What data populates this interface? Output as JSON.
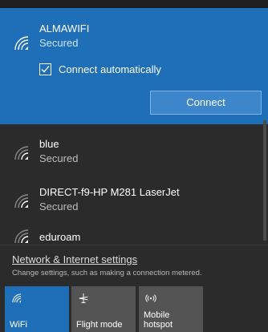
{
  "selected_network": {
    "ssid": "ALMAWIFI",
    "status": "Secured",
    "auto_connect_label": "Connect automatically",
    "auto_connect_checked": true,
    "connect_label": "Connect",
    "icon": "wifi-secured-icon"
  },
  "networks": [
    {
      "ssid": "blue",
      "status": "Secured",
      "icon": "wifi-secured-icon"
    },
    {
      "ssid": "DIRECT-f9-HP M281 LaserJet",
      "status": "Secured",
      "icon": "wifi-secured-icon"
    },
    {
      "ssid": "eduroam",
      "status": "",
      "icon": "wifi-secured-icon"
    }
  ],
  "settings": {
    "link": "Network & Internet settings",
    "description": "Change settings, such as making a connection metered."
  },
  "quick_actions": [
    {
      "label": "WiFi",
      "icon": "wifi-icon",
      "active": true
    },
    {
      "label": "Flight mode",
      "icon": "airplane-icon",
      "active": false
    },
    {
      "label": "Mobile hotspot",
      "icon": "hotspot-icon",
      "active": false
    }
  ],
  "colors": {
    "accent": "#1e6fb8",
    "background": "#2b2b2b",
    "tile_inactive": "#545454"
  }
}
